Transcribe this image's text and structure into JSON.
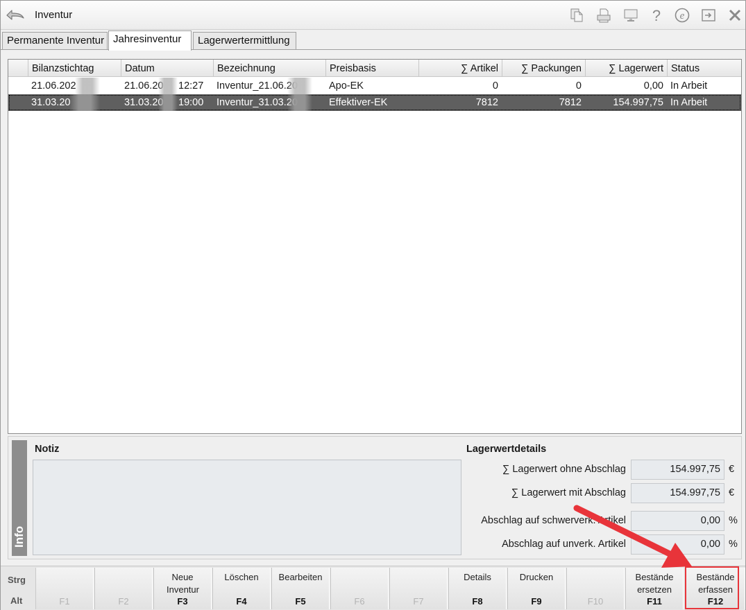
{
  "window": {
    "title": "Inventur",
    "toolbar_icons": [
      "documents-icon",
      "printer-icon",
      "monitor-icon",
      "help-icon",
      "e-icon",
      "export-icon",
      "close-icon"
    ]
  },
  "tabs": [
    {
      "label": "Permanente Inventur",
      "active": false
    },
    {
      "label": "Jahresinventur",
      "active": true
    },
    {
      "label": "Lagerwertermittlung",
      "active": false
    }
  ],
  "grid": {
    "columns": [
      "Bilanzstichtag",
      "Datum",
      "Bezeichnung",
      "Preisbasis",
      "∑ Artikel",
      "∑ Packungen",
      "∑ Lagerwert",
      "Status"
    ],
    "rows": [
      {
        "bilanzstichtag": "21.06.202",
        "datum": "21.06.20",
        "zeit": "12:27",
        "bezeichnung": "Inventur_21.06.20",
        "preisbasis": "Apo-EK",
        "artikel": "0",
        "packungen": "0",
        "lagerwert": "0,00",
        "status": "In Arbeit",
        "selected": false
      },
      {
        "bilanzstichtag": "31.03.20",
        "datum": "31.03.20",
        "zeit": "19:00",
        "bezeichnung": "Inventur_31.03.20",
        "preisbasis": "Effektiver-EK",
        "artikel": "7812",
        "packungen": "7812",
        "lagerwert": "154.997,75",
        "status": "In Arbeit",
        "selected": true
      }
    ]
  },
  "info": {
    "side_label": "Info",
    "notiz_title": "Notiz",
    "notiz_value": "",
    "details_title": "Lagerwertdetails",
    "details": [
      {
        "label": "∑ Lagerwert ohne Abschlag",
        "value": "154.997,75",
        "unit": "€"
      },
      {
        "label": "∑ Lagerwert mit Abschlag",
        "value": "154.997,75",
        "unit": "€"
      },
      {
        "label": "Abschlag auf schwerverk. Artikel",
        "value": "0,00",
        "unit": "%"
      },
      {
        "label": "Abschlag auf unverk. Artikel",
        "value": "0,00",
        "unit": "%"
      }
    ]
  },
  "fkeys": {
    "strg": "Strg",
    "alt": "Alt",
    "keys": [
      {
        "label": "",
        "key": "F1",
        "enabled": false
      },
      {
        "label": "",
        "key": "F2",
        "enabled": false
      },
      {
        "label": "Neue Inventur",
        "key": "F3",
        "enabled": true
      },
      {
        "label": "Löschen",
        "key": "F4",
        "enabled": true
      },
      {
        "label": "Bearbeiten",
        "key": "F5",
        "enabled": true
      },
      {
        "label": "",
        "key": "F6",
        "enabled": false
      },
      {
        "label": "",
        "key": "F7",
        "enabled": false
      },
      {
        "label": "Details",
        "key": "F8",
        "enabled": true
      },
      {
        "label": "Drucken",
        "key": "F9",
        "enabled": true
      },
      {
        "label": "",
        "key": "F10",
        "enabled": false
      },
      {
        "label": "Bestände ersetzen",
        "key": "F11",
        "enabled": true
      },
      {
        "label": "Bestände erfassen",
        "key": "F12",
        "enabled": true
      }
    ]
  },
  "colors": {
    "selected_row": "#5f5f5f",
    "highlight": "#e8343a",
    "info_strip": "#8d8d8d",
    "field_bg": "#e8ebee"
  }
}
